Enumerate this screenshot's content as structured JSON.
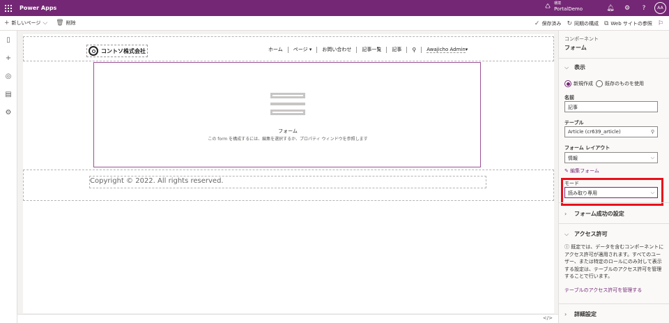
{
  "topbar": {
    "app_title": "Power Apps",
    "env_label": "環境",
    "env_value": "PortalDemo",
    "avatar": "AA",
    "icons": [
      "environment-icon",
      "bell-icon",
      "gear-icon",
      "help-icon"
    ]
  },
  "cmdbar": {
    "new_page": "新しいページ",
    "delete": "削除",
    "saved": "保存済み",
    "sync": "同期の構成",
    "browse": "Web サイトの参照"
  },
  "site": {
    "logo_text": "コントソ株式会社",
    "nav": [
      "ホーム",
      "ページ",
      "お問い合わせ",
      "記事一覧",
      "記事"
    ],
    "user": "Awajicho Admin",
    "form_label": "フォーム",
    "form_hint": "この form を構成するには、編集を選択するか、プロパティ ウィンドウを参照します",
    "copyright": "Copyright © 2022. All rights reserved."
  },
  "panel": {
    "component_label": "コンポーネント",
    "component_name": "フォーム",
    "display_section": "表示",
    "radio_new": "新規作成",
    "radio_existing": "既存のものを使用",
    "name_label": "名前",
    "name_value": "記事",
    "table_label": "テーブル",
    "table_value": "Article (cr639_article)",
    "layout_label": "フォーム レイアウト",
    "layout_value": "情報",
    "edit_form": "編集フォーム",
    "mode_label": "モード",
    "mode_value": "読み取り専用",
    "success_section": "フォーム成功の設定",
    "access_section": "アクセス許可",
    "access_note": "既定では、データを含むコンポーネントにアクセス許可が適用されます。すべてのユーザー、または特定のロールにのみ対して表示する設定は、テーブルのアクセス許可を管理することで行います。",
    "manage_link": "テーブルのアクセス許可を管理する",
    "advanced_section": "詳細設定"
  },
  "colors": {
    "brand": "#742774",
    "highlight": "#e8101a"
  }
}
